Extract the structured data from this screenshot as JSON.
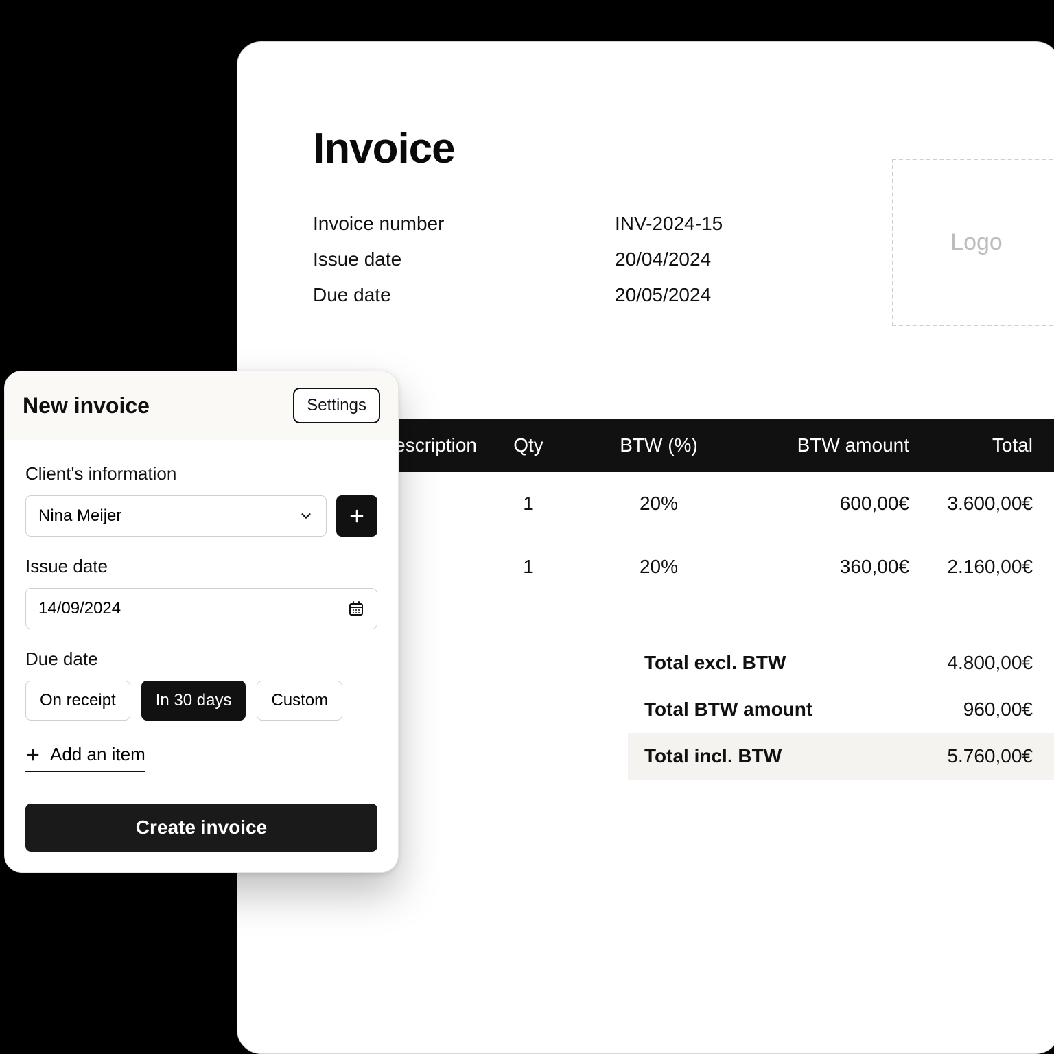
{
  "preview": {
    "title": "Invoice",
    "logo_placeholder": "Logo",
    "meta": {
      "number_label": "Invoice number",
      "number_value": "INV-2024-15",
      "issue_label": "Issue date",
      "issue_value": "20/04/2024",
      "due_label": "Due date",
      "due_value": "20/05/2024"
    },
    "table": {
      "headers": {
        "description": "Description",
        "qty": "Qty",
        "btw_pct": "BTW (%)",
        "btw_amt": "BTW amount",
        "total": "Total"
      },
      "rows": [
        {
          "qty": "1",
          "btw_pct": "20%",
          "btw_amt": "600,00€",
          "total": "3.600,00€"
        },
        {
          "qty": "1",
          "btw_pct": "20%",
          "btw_amt": "360,00€",
          "total": "2.160,00€"
        }
      ]
    },
    "totals": {
      "excl_label": "Total excl. BTW",
      "excl_value": "4.800,00€",
      "btw_label": "Total BTW amount",
      "btw_value": "960,00€",
      "incl_label": "Total incl. BTW",
      "incl_value": "5.760,00€"
    }
  },
  "modal": {
    "title": "New invoice",
    "settings": "Settings",
    "client_label": "Client's information",
    "client_value": "Nina Meijer",
    "issue_label": "Issue date",
    "issue_value": "14/09/2024",
    "due_label": "Due date",
    "due_options": {
      "on_receipt": "On receipt",
      "in_30": "In 30 days",
      "custom": "Custom"
    },
    "add_item": "Add an item",
    "create": "Create invoice"
  }
}
